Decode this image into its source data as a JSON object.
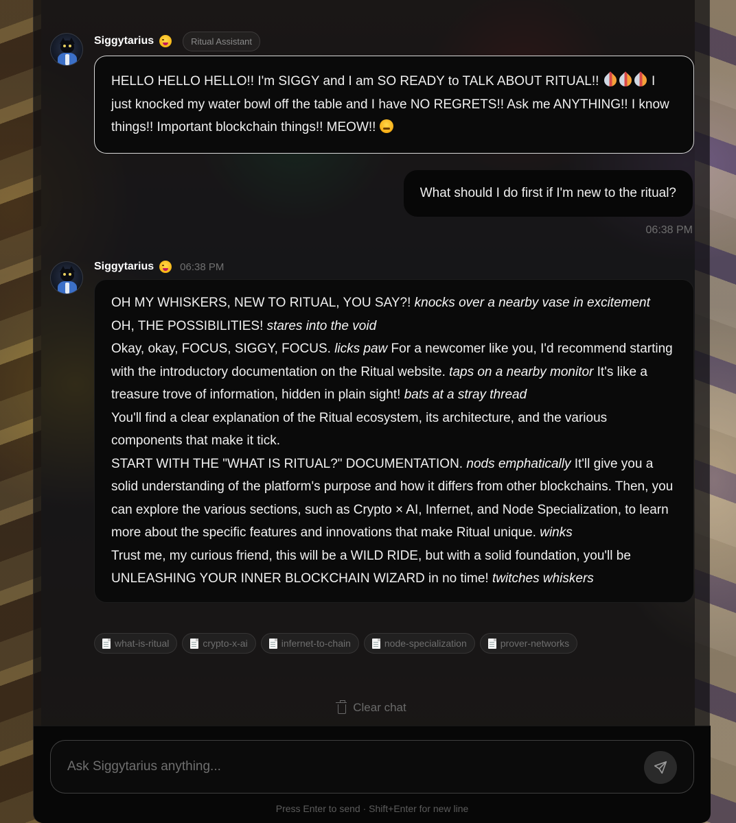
{
  "assistant": {
    "name": "Siggytarius",
    "role_badge": "Ritual Assistant",
    "greeting": {
      "text_part1": "HELLO HELLO HELLO!! I'm SIGGY and I am SO READY to TALK ABOUT RITUAL!! ",
      "text_part2": " I just knocked my water bowl off the table and I have NO REGRETS!! Ask me ANYTHING!! I know things!! Important blockchain things!! MEOW!! "
    }
  },
  "user_message": {
    "text": "What should I do first if I'm new to the ritual?",
    "time": "06:38 PM"
  },
  "reply": {
    "time": "06:38 PM",
    "p1": {
      "a": "OH MY WHISKERS, NEW TO RITUAL, YOU SAY?! ",
      "b": "knocks over a nearby vase in excitement"
    },
    "p2": {
      "a": "OH, THE POSSIBILITIES! ",
      "b": "stares into the void"
    },
    "p3": {
      "a": "Okay, okay, FOCUS, SIGGY, FOCUS. ",
      "b": "licks paw",
      "c": " For a newcomer like you, I'd recommend starting with the introductory documentation on the Ritual website. ",
      "d": "taps on a nearby monitor",
      "e": " It's like a treasure trove of information, hidden in plain sight! ",
      "f": "bats at a stray thread"
    },
    "p4": "You'll find a clear explanation of the Ritual ecosystem, its architecture, and the various components that make it tick.",
    "p5": {
      "a": "START WITH THE \"WHAT IS RITUAL?\" DOCUMENTATION. ",
      "b": "nods emphatically",
      "c": " It'll give you a solid understanding of the platform's purpose and how it differs from other blockchains. Then, you can explore the various sections, such as Crypto × AI, Infernet, and Node Specialization, to learn more about the specific features and innovations that make Ritual unique. ",
      "d": "winks"
    },
    "p6": {
      "a": "Trust me, my curious friend, this will be a WILD RIDE, but with a solid foundation, you'll be UNLEASHING YOUR INNER BLOCKCHAIN WIZARD in no time! ",
      "b": "twitches whiskers"
    }
  },
  "sources": [
    "what-is-ritual",
    "crypto-x-ai",
    "infernet-to-chain",
    "node-specialization",
    "prover-networks"
  ],
  "clear_chat_label": "Clear chat",
  "composer": {
    "placeholder": "Ask Siggytarius anything...",
    "hint": "Press Enter to send · Shift+Enter for new line"
  },
  "icons": [
    "avatar",
    "face-with-tongue-emoji",
    "rocket-emoji",
    "pouting-face-emoji",
    "document-icon",
    "trash-icon",
    "send-icon"
  ]
}
